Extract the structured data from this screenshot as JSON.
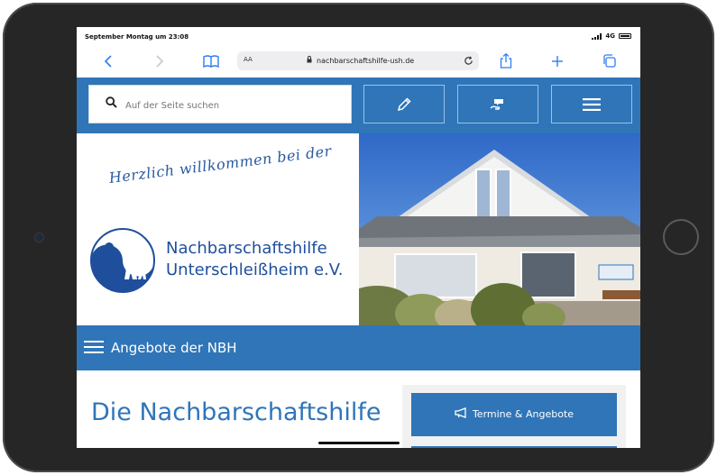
{
  "status_bar": {
    "time": "September Montag um 23:08",
    "network": "4G"
  },
  "browser": {
    "text_size_label": "AA",
    "url": "nachbarschaftshilfe-ush.de",
    "icons": [
      "back-icon",
      "forward-icon",
      "bookmarks-icon",
      "lock-icon",
      "reload-icon",
      "share-icon",
      "new-tab-icon",
      "tabs-icon"
    ]
  },
  "header": {
    "search_placeholder": "Auf der Seite suchen",
    "buttons": [
      "pencil-icon",
      "hand-heart-icon",
      "menu-icon"
    ]
  },
  "hero": {
    "welcome": "Herzlich willkommen bei der",
    "org_line1": "Nachbarschaftshilfe",
    "org_line2": "Unterschleißheim e.V."
  },
  "nav": {
    "label": "Angebote der NBH"
  },
  "main": {
    "title": "Die Nachbarschaftshilfe",
    "sidebar_button": "Termine & Angebote"
  },
  "colors": {
    "brand_blue": "#2f75b8",
    "logo_blue": "#1f4f9c",
    "ios_blue": "#2f7cf6"
  }
}
